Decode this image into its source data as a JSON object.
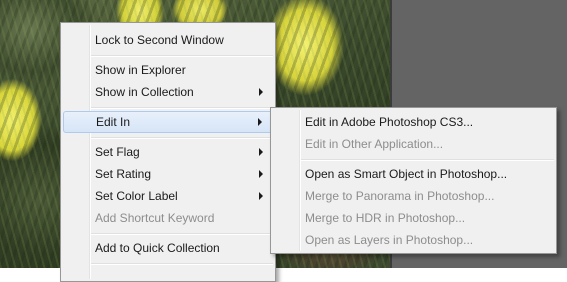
{
  "main_menu": {
    "items": [
      {
        "label": "Lock to Second Window",
        "disabled": false,
        "submenu": false
      },
      {
        "label": "Show in Explorer",
        "disabled": false,
        "submenu": false
      },
      {
        "label": "Show in Collection",
        "disabled": false,
        "submenu": true
      },
      {
        "label": "Edit In",
        "disabled": false,
        "submenu": true,
        "highlighted": true
      },
      {
        "label": "Set Flag",
        "disabled": false,
        "submenu": true
      },
      {
        "label": "Set Rating",
        "disabled": false,
        "submenu": true
      },
      {
        "label": "Set Color Label",
        "disabled": false,
        "submenu": true
      },
      {
        "label": "Add Shortcut Keyword",
        "disabled": true,
        "submenu": false
      },
      {
        "label": "Add to Quick Collection",
        "disabled": false,
        "submenu": false
      }
    ]
  },
  "edit_in_submenu": {
    "items": [
      {
        "label": "Edit in Adobe Photoshop CS3...",
        "disabled": false
      },
      {
        "label": "Edit in Other Application...",
        "disabled": true
      },
      {
        "label": "Open as Smart Object in Photoshop...",
        "disabled": false
      },
      {
        "label": "Merge to Panorama in Photoshop...",
        "disabled": true
      },
      {
        "label": "Merge to HDR in Photoshop...",
        "disabled": true
      },
      {
        "label": "Open as Layers in Photoshop...",
        "disabled": true
      }
    ]
  }
}
